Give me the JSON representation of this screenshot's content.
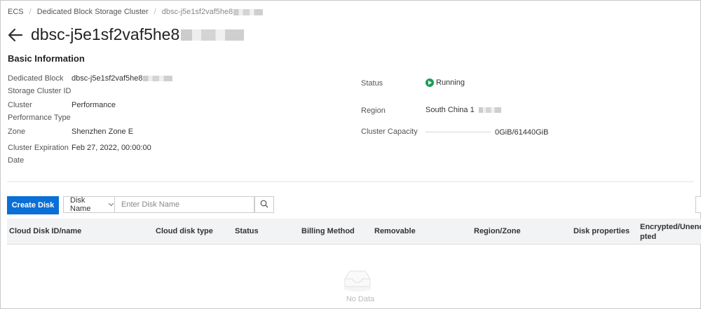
{
  "breadcrumb": {
    "items": [
      "ECS",
      "Dedicated Block Storage Cluster",
      "dbsc-j5e1sf2vaf5he8"
    ],
    "separator": "/"
  },
  "header": {
    "title": "dbsc-j5e1sf2vaf5he8"
  },
  "basic_info": {
    "section_title": "Basic Information",
    "cluster_id_label_line1": "Dedicated Block",
    "cluster_id_label_line2": "Storage Cluster ID",
    "cluster_id_value": "dbsc-j5e1sf2vaf5he8",
    "perf_label_line1": "Cluster",
    "perf_label_line2": "Performance Type",
    "perf_value": "Performance",
    "zone_label": "Zone",
    "zone_value": "Shenzhen Zone E",
    "expiry_label_line1": "Cluster Expiration",
    "expiry_label_line2": "Date",
    "expiry_value": "Feb 27, 2022, 00:00:00",
    "status_label": "Status",
    "status_value": "Running",
    "region_label": "Region",
    "region_value": "South China 1",
    "capacity_label": "Cluster Capacity",
    "capacity_value": "0GiB/61440GiB",
    "capacity_used_fraction": 0
  },
  "toolbar": {
    "create_label": "Create Disk",
    "filter_field": "Disk Name",
    "search_placeholder": "Enter Disk Name"
  },
  "table": {
    "columns": {
      "id": "Cloud Disk ID/name",
      "type": "Cloud disk type",
      "status": "Status",
      "billing": "Billing Method",
      "removable": "Removable",
      "region": "Region/Zone",
      "properties": "Disk properties",
      "encrypted_line1": "Encrypted/Unencry",
      "encrypted_line2": "pted"
    },
    "empty_text": "No Data"
  },
  "colors": {
    "primary": "#0a6fd6",
    "running": "#1e9e5a",
    "header_bg": "#f2f3f5"
  }
}
